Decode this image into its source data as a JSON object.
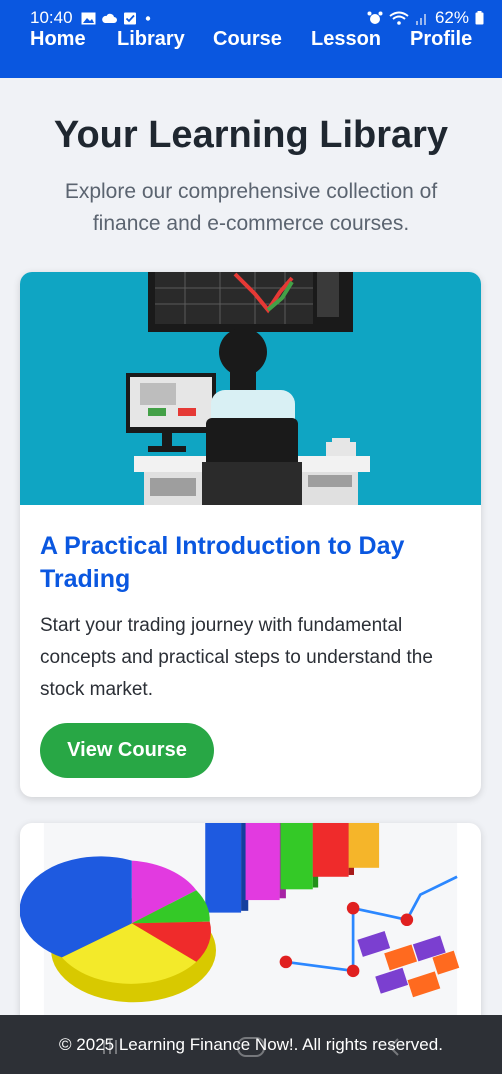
{
  "status_bar": {
    "time": "10:40",
    "battery": "62%"
  },
  "nav": {
    "items": [
      "Home",
      "Library",
      "Course",
      "Lesson",
      "Profile"
    ]
  },
  "hero": {
    "title": "Your Learning Library",
    "subtitle": "Explore our comprehensive collection of finance and e-commerce courses."
  },
  "courses": [
    {
      "title": "A Practical Introduction to Day Trading",
      "description": "Start your trading journey with fundamental concepts and practical steps to understand the stock market.",
      "button": "View Course"
    }
  ],
  "footer": {
    "text": "© 2025 Learning Finance Now!. All rights reserved."
  },
  "colors": {
    "primary": "#0a57e0",
    "accent": "#28a745",
    "footer": "#2d3036",
    "background": "#f0f2f6"
  }
}
